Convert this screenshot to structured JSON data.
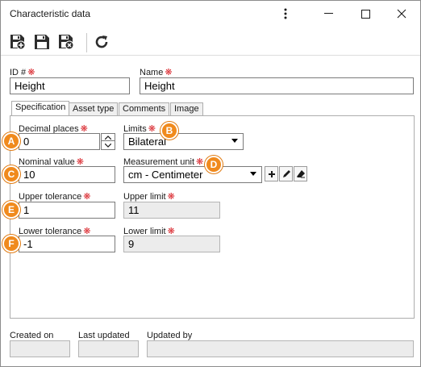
{
  "window": {
    "title": "Characteristic data"
  },
  "titlebar": {
    "more_icon": "vertical-ellipsis",
    "minimize_icon": "minimize",
    "maximize_icon": "maximize",
    "close_icon": "close"
  },
  "toolbar": {
    "items": [
      "save-and-new-icon",
      "save-icon",
      "save-and-close-icon",
      "refresh-icon"
    ]
  },
  "form": {
    "id_label": "ID #",
    "id_value": "Height",
    "name_label": "Name",
    "name_value": "Height"
  },
  "tabs": [
    {
      "label": "Specification",
      "active": true
    },
    {
      "label": "Asset type",
      "active": false
    },
    {
      "label": "Comments",
      "active": false
    },
    {
      "label": "Image",
      "active": false
    }
  ],
  "specification": {
    "decimal_places_label": "Decimal places",
    "decimal_places_value": "0",
    "limits_label": "Limits",
    "limits_value": "Bilateral",
    "nominal_value_label": "Nominal value",
    "nominal_value_value": "10",
    "measurement_unit_label": "Measurement unit",
    "measurement_unit_value": "cm - Centimeter",
    "upper_tolerance_label": "Upper tolerance",
    "upper_tolerance_value": "1",
    "upper_limit_label": "Upper limit",
    "upper_limit_value": "11",
    "lower_tolerance_label": "Lower tolerance",
    "lower_tolerance_value": "-1",
    "lower_limit_label": "Lower limit",
    "lower_limit_value": "9"
  },
  "footer": {
    "created_on_label": "Created on",
    "last_updated_label": "Last updated",
    "updated_by_label": "Updated by"
  },
  "callouts": {
    "a": "A",
    "b": "B",
    "c": "C",
    "d": "D",
    "e": "E",
    "f": "F"
  },
  "colors": {
    "required_marker": "#d9262c",
    "callout_badge": "#f08a1d",
    "readonly_bg": "#ececec"
  }
}
